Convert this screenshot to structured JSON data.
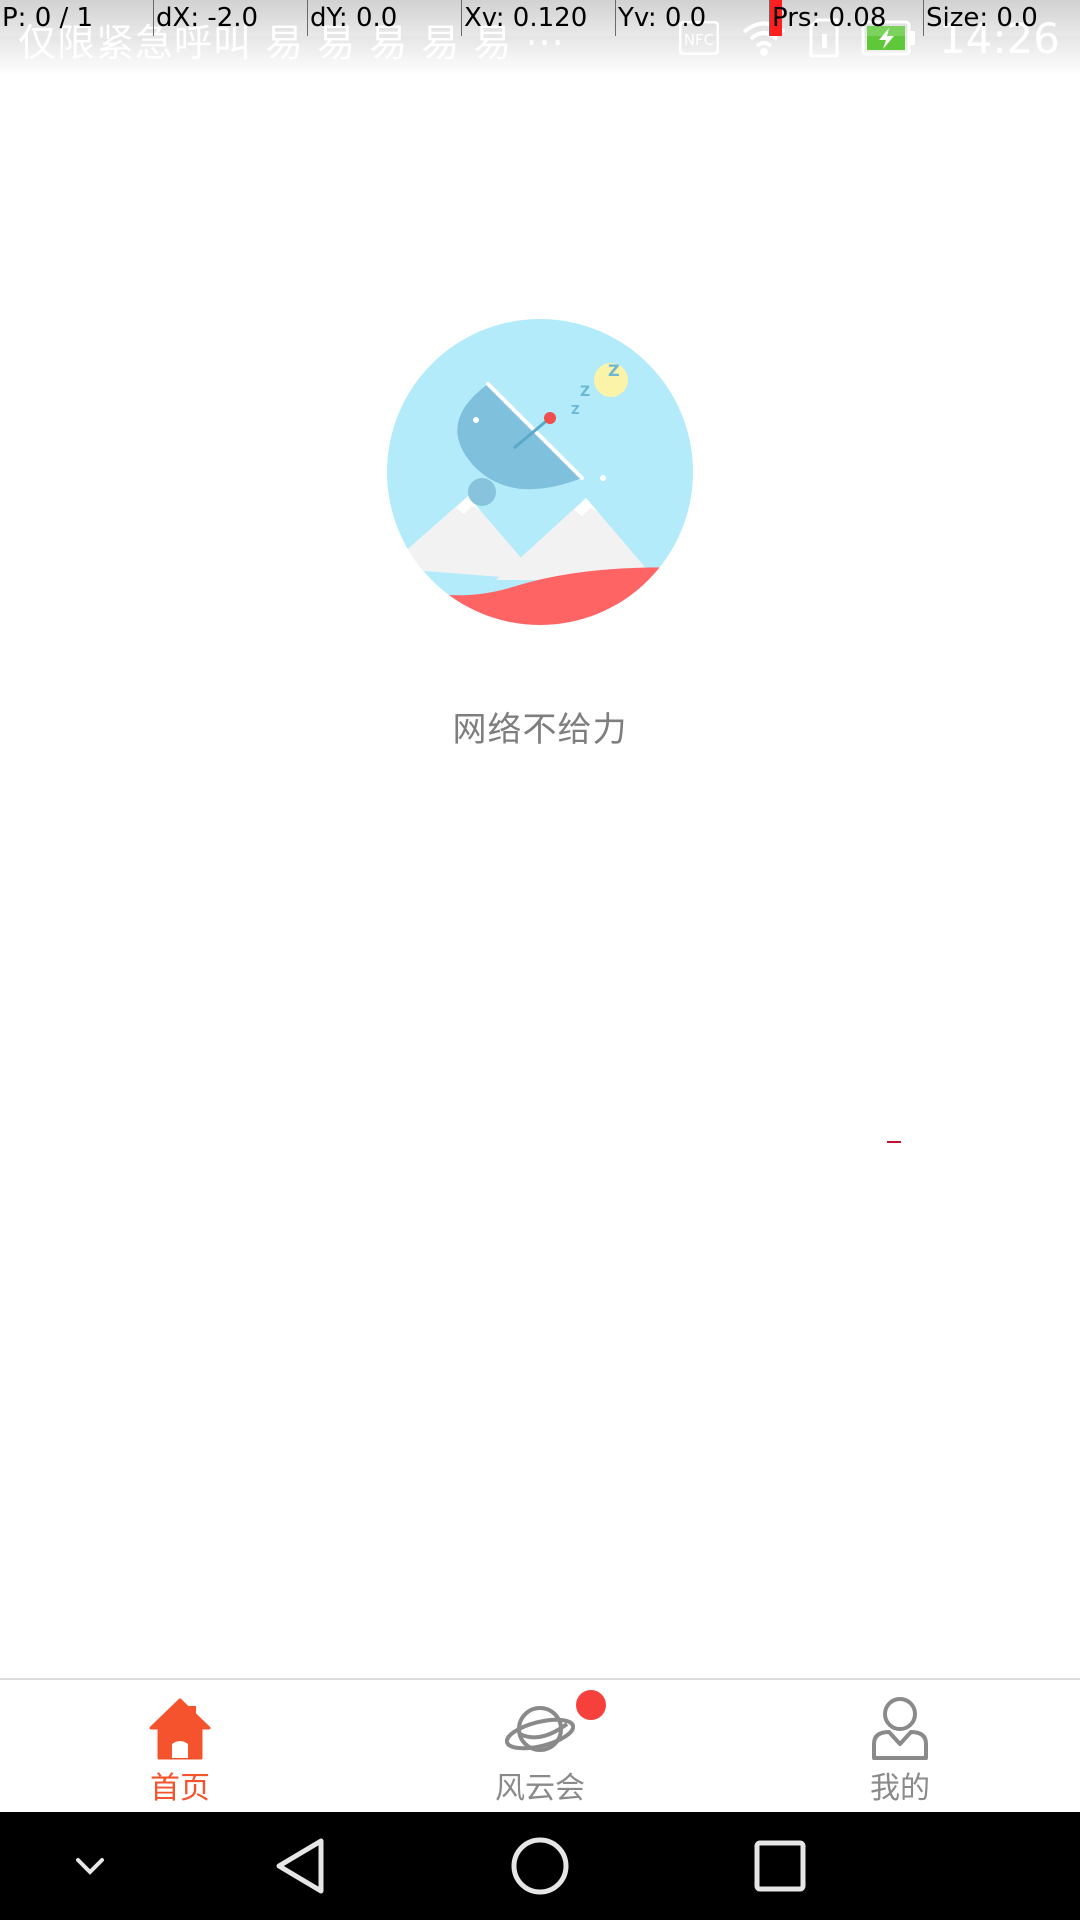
{
  "status_bar": {
    "carrier_text": "仅限紧急呼叫 易 易 易 易 易 ···",
    "nfc_label": "NFC",
    "time": "14:26",
    "icons": [
      "nfc-icon",
      "wifi-icon",
      "sim-icon",
      "battery-charging-icon"
    ]
  },
  "debug_overlay": {
    "pointer": "P: 0 / 1",
    "dx": "dX: -2.0",
    "dy": "dY: 0.0",
    "xv": "Xv: 0.120",
    "yv": "Yv: 0.0",
    "prs": "Prs: 0.08",
    "size": "Size: 0.0"
  },
  "empty_state": {
    "illustration": "sleeping-satellite-dish-illustration",
    "message": "网络不给力"
  },
  "tab_bar": {
    "tabs": [
      {
        "label": "首页",
        "icon": "home-icon",
        "active": true
      },
      {
        "label": "风云会",
        "icon": "planet-icon",
        "active": false,
        "badge": true
      },
      {
        "label": "我的",
        "icon": "user-profile-icon",
        "active": false
      }
    ]
  },
  "nav_bar": {
    "buttons": [
      "collapse-icon",
      "back-icon",
      "home-circle-icon",
      "recents-icon"
    ]
  },
  "colors": {
    "accent": "#f5532d",
    "badge": "#f5403c",
    "inactive_tab": "#8a8a8a",
    "illustration_sky": "#b3ebfb",
    "illustration_ground": "#ff6464"
  }
}
